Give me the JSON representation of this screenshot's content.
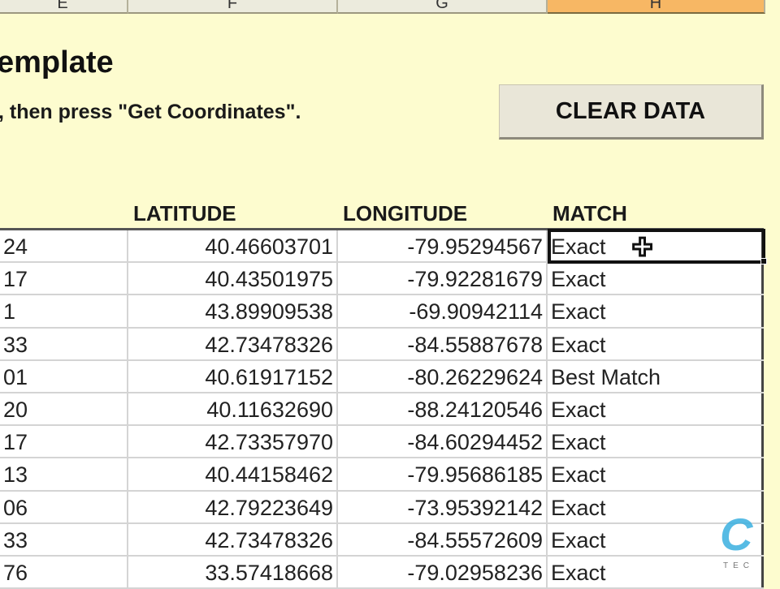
{
  "column_headers": [
    {
      "label": "E"
    },
    {
      "label": "F"
    },
    {
      "label": "G"
    },
    {
      "label": "H",
      "selected": true
    }
  ],
  "sheet": {
    "title": "emplate",
    "instruction": ", then press \"Get Coordinates\".",
    "clear_button": "CLEAR DATA"
  },
  "table": {
    "headers": {
      "lat": "LATITUDE",
      "lon": "LONGITUDE",
      "match": "MATCH"
    },
    "rows": [
      {
        "id": "24",
        "lat": "40.46603701",
        "lon": "-79.95294567",
        "match": "Exact"
      },
      {
        "id": "17",
        "lat": "40.43501975",
        "lon": "-79.92281679",
        "match": "Exact"
      },
      {
        "id": "1",
        "lat": "43.89909538",
        "lon": "-69.90942114",
        "match": "Exact"
      },
      {
        "id": "33",
        "lat": "42.73478326",
        "lon": "-84.55887678",
        "match": "Exact"
      },
      {
        "id": "01",
        "lat": "40.61917152",
        "lon": "-80.26229624",
        "match": "Best Match"
      },
      {
        "id": "20",
        "lat": "40.11632690",
        "lon": "-88.24120546",
        "match": "Exact"
      },
      {
        "id": "17",
        "lat": "42.73357970",
        "lon": "-84.60294452",
        "match": "Exact"
      },
      {
        "id": "13",
        "lat": "40.44158462",
        "lon": "-79.95686185",
        "match": "Exact"
      },
      {
        "id": "06",
        "lat": "42.79223649",
        "lon": "-73.95392142",
        "match": "Exact"
      },
      {
        "id": "33",
        "lat": "42.73478326",
        "lon": "-84.55572609",
        "match": "Exact"
      },
      {
        "id": "76",
        "lat": "33.57418668",
        "lon": "-79.02958236",
        "match": "Exact"
      }
    ]
  },
  "watermark": {
    "text": "CI",
    "sub": "TECH"
  },
  "colors": {
    "sheet_bg": "#fdfccf",
    "selected_header": "#f7b764",
    "logo": "#3ab0e0"
  }
}
